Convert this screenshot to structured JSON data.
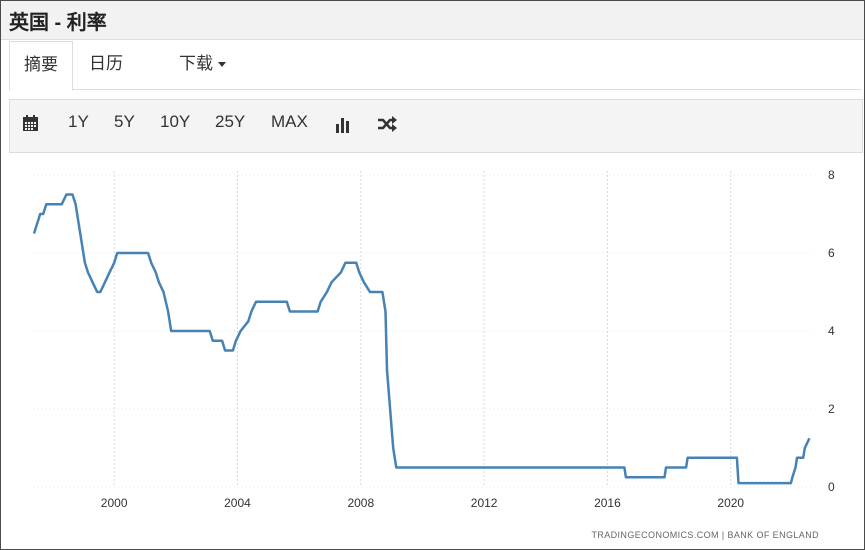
{
  "title": "英国 - 利率",
  "tabs": {
    "summary": "摘要",
    "calendar": "日历",
    "download": "下载"
  },
  "toolbar": {
    "btn_1y": "1Y",
    "btn_5y": "5Y",
    "btn_10y": "10Y",
    "btn_25y": "25Y",
    "btn_max": "MAX"
  },
  "icons": {
    "calendar": "calendar-icon",
    "bar_chart": "bar-chart-icon",
    "shuffle": "shuffle-icon"
  },
  "chart_data": {
    "type": "line",
    "title": "",
    "xlabel": "",
    "ylabel": "",
    "xlim": [
      1997.4,
      2022.7
    ],
    "ylim": [
      0,
      8
    ],
    "x_ticks": [
      2000,
      2004,
      2008,
      2012,
      2016,
      2020
    ],
    "y_ticks": [
      0,
      2,
      4,
      6,
      8
    ],
    "grid": "vertical",
    "color": "#4682b4",
    "source": "TRADINGECONOMICS.COM  |  BANK OF ENGLAND",
    "series": [
      {
        "points": [
          [
            1997.4,
            6.5
          ],
          [
            1997.5,
            6.75
          ],
          [
            1997.6,
            7
          ],
          [
            1997.7,
            7
          ],
          [
            1997.8,
            7.25
          ],
          [
            1998.0,
            7.25
          ],
          [
            1998.3,
            7.25
          ],
          [
            1998.45,
            7.5
          ],
          [
            1998.65,
            7.5
          ],
          [
            1998.75,
            7.25
          ],
          [
            1998.85,
            6.75
          ],
          [
            1998.95,
            6.25
          ],
          [
            1999.05,
            5.75
          ],
          [
            1999.15,
            5.5
          ],
          [
            1999.3,
            5.25
          ],
          [
            1999.45,
            5
          ],
          [
            1999.55,
            5
          ],
          [
            1999.7,
            5.25
          ],
          [
            1999.85,
            5.5
          ],
          [
            2000.0,
            5.75
          ],
          [
            2000.1,
            6
          ],
          [
            2001.1,
            6
          ],
          [
            2001.2,
            5.75
          ],
          [
            2001.35,
            5.5
          ],
          [
            2001.45,
            5.25
          ],
          [
            2001.6,
            5
          ],
          [
            2001.75,
            4.5
          ],
          [
            2001.85,
            4
          ],
          [
            2003.1,
            4
          ],
          [
            2003.2,
            3.75
          ],
          [
            2003.5,
            3.75
          ],
          [
            2003.6,
            3.5
          ],
          [
            2003.85,
            3.5
          ],
          [
            2003.95,
            3.75
          ],
          [
            2004.1,
            4
          ],
          [
            2004.35,
            4.25
          ],
          [
            2004.45,
            4.5
          ],
          [
            2004.6,
            4.75
          ],
          [
            2005.6,
            4.75
          ],
          [
            2005.7,
            4.5
          ],
          [
            2006.6,
            4.5
          ],
          [
            2006.7,
            4.75
          ],
          [
            2006.9,
            5
          ],
          [
            2007.05,
            5.25
          ],
          [
            2007.35,
            5.5
          ],
          [
            2007.5,
            5.75
          ],
          [
            2007.85,
            5.75
          ],
          [
            2007.95,
            5.5
          ],
          [
            2008.1,
            5.25
          ],
          [
            2008.3,
            5
          ],
          [
            2008.7,
            5
          ],
          [
            2008.8,
            4.5
          ],
          [
            2008.85,
            3
          ],
          [
            2008.95,
            2
          ],
          [
            2009.05,
            1
          ],
          [
            2009.15,
            0.5
          ],
          [
            2016.55,
            0.5
          ],
          [
            2016.6,
            0.25
          ],
          [
            2017.85,
            0.25
          ],
          [
            2017.9,
            0.5
          ],
          [
            2018.55,
            0.5
          ],
          [
            2018.6,
            0.75
          ],
          [
            2020.2,
            0.75
          ],
          [
            2020.25,
            0.1
          ],
          [
            2021.95,
            0.1
          ],
          [
            2022.0,
            0.25
          ],
          [
            2022.1,
            0.5
          ],
          [
            2022.15,
            0.75
          ],
          [
            2022.35,
            0.75
          ],
          [
            2022.4,
            1
          ],
          [
            2022.55,
            1.25
          ]
        ]
      }
    ]
  }
}
